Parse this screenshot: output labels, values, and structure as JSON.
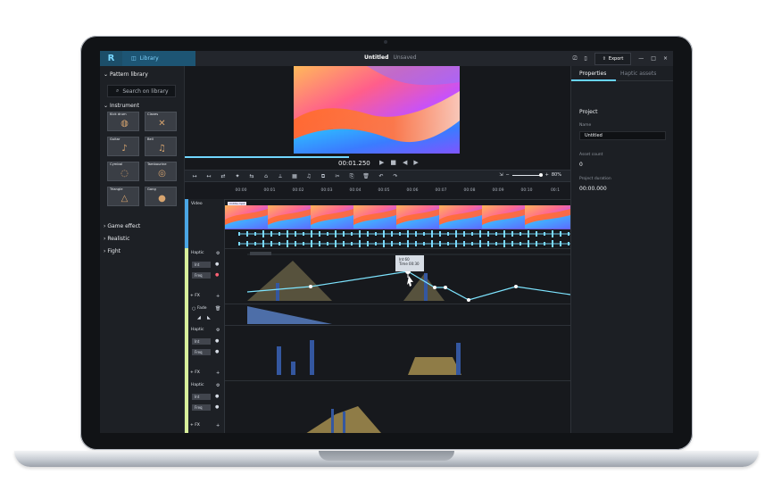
{
  "app": {
    "logo": "R",
    "library_tab": "Library",
    "title": "Untitled",
    "title_status": "Unsaved",
    "export_button": "Export"
  },
  "left_panel": {
    "title": "Pattern library",
    "search_placeholder": "Search on library",
    "sections": {
      "instrument": "Instrument",
      "game_effect": "Game effect",
      "realistic": "Realistic",
      "fight": "Fight"
    },
    "thumbs": [
      {
        "label": "Kick drum",
        "icon": "drum-icon"
      },
      {
        "label": "Claves",
        "icon": "claves-icon"
      },
      {
        "label": "Guitar",
        "icon": "guitar-icon"
      },
      {
        "label": "Bell",
        "icon": "bell-icon"
      },
      {
        "label": "Cymbal",
        "icon": "cymbal-icon"
      },
      {
        "label": "Tambourine",
        "icon": "tambourine-icon"
      },
      {
        "label": "Triangle",
        "icon": "triangle-icon"
      },
      {
        "label": "Gong",
        "icon": "gong-icon"
      }
    ]
  },
  "player": {
    "timecode": "00:01.250"
  },
  "toolbar": {
    "zoom": "80%"
  },
  "timeline": {
    "ticks": [
      "00:00",
      "00:01",
      "00:02",
      "00:03",
      "00:04",
      "00:05",
      "00:06",
      "00:07",
      "00:08",
      "00:09",
      "00:10",
      "00:1"
    ],
    "video_track_label": "Video",
    "video_chip": "Untitle.mp4",
    "haptic_track_label": "Haptic",
    "int_label": "Int",
    "freq_label": "Freq",
    "fx_label": "FX",
    "fade_label": "Fade",
    "tooltip_int": "Int  60",
    "tooltip_time": "Time 00:30"
  },
  "right_panel": {
    "tabs": [
      "Properties",
      "Haptic assets"
    ],
    "project_title": "Project",
    "name_label": "Name",
    "name_value": "Untitled",
    "asset_count_label": "Asset count",
    "asset_count_value": "0",
    "duration_label": "Project duration",
    "duration_value": "00:00.000"
  },
  "colors": {
    "accent": "#68d4ff",
    "video_track": "#4aa6e5",
    "haptic_track": "#d8ef9b"
  }
}
